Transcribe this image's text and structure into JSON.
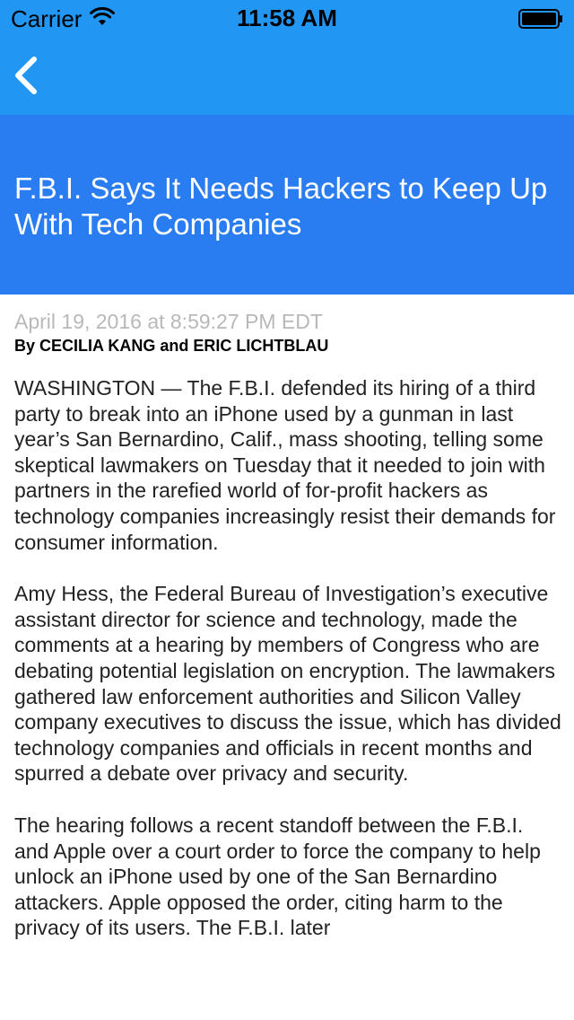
{
  "status_bar": {
    "carrier": "Carrier",
    "time": "11:58 AM"
  },
  "colors": {
    "nav_blue": "#2196f3",
    "header_blue": "#2a7df0",
    "timestamp_gray": "#b8b8b8"
  },
  "nav": {
    "back_icon": "chevron-left-icon"
  },
  "article": {
    "headline": "F.B.I. Says It Needs Hackers to Keep Up With Tech Companies",
    "timestamp": "April 19, 2016 at 8:59:27 PM EDT",
    "byline": "By CECILIA KANG and ERIC LICHTBLAU",
    "paragraphs": [
      "WASHINGTON — The F.B.I. defended its hiring of a third party to break into an iPhone used by a gunman in last year’s San Bernardino, Calif., mass shooting, telling some skeptical lawmakers on Tuesday that it needed to join with partners in the rarefied world of for-profit hackers as technology companies increasingly resist their demands for consumer information.",
      "Amy Hess, the Federal Bureau of Investigation’s executive assistant director for science and technology, made the comments at a hearing by members of Congress who are debating potential legislation on encryption. The lawmakers gathered law enforcement authorities and Silicon Valley company executives to discuss the issue, which has divided technology companies and officials in recent months and spurred a debate over privacy and security.",
      "The hearing follows a recent standoff between the F.B.I. and Apple over a court order to force the company to help unlock an iPhone used by one of the San Bernardino attackers. Apple opposed the order, citing harm to the privacy of its users. The F.B.I. later"
    ]
  }
}
